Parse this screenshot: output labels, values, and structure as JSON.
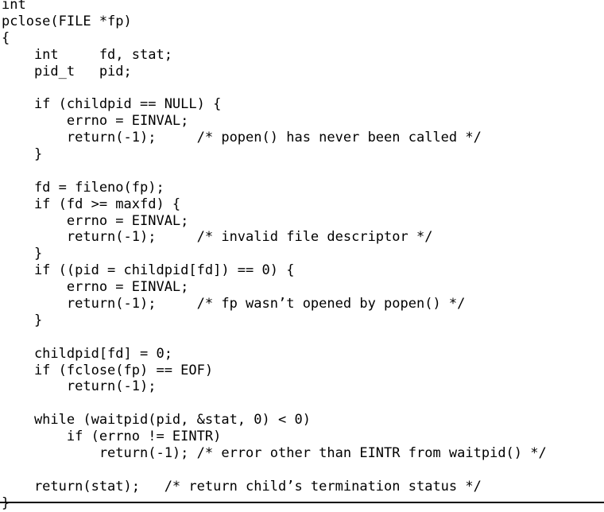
{
  "listing": {
    "lines": [
      "int",
      "pclose(FILE *fp)",
      "{",
      "    int     fd, stat;",
      "    pid_t   pid;",
      "",
      "    if (childpid == NULL) {",
      "        errno = EINVAL;",
      "        return(-1);     /* popen() has never been called */",
      "    }",
      "",
      "    fd = fileno(fp);",
      "    if (fd >= maxfd) {",
      "        errno = EINVAL;",
      "        return(-1);     /* invalid file descriptor */",
      "    }",
      "    if ((pid = childpid[fd]) == 0) {",
      "        errno = EINVAL;",
      "        return(-1);     /* fp wasn’t opened by popen() */",
      "    }",
      "",
      "    childpid[fd] = 0;",
      "    if (fclose(fp) == EOF)",
      "        return(-1);",
      "",
      "    while (waitpid(pid, &stat, 0) < 0)",
      "        if (errno != EINTR)",
      "            return(-1); /* error other than EINTR from waitpid() */",
      "",
      "    return(stat);   /* return child’s termination status */",
      "}"
    ]
  }
}
